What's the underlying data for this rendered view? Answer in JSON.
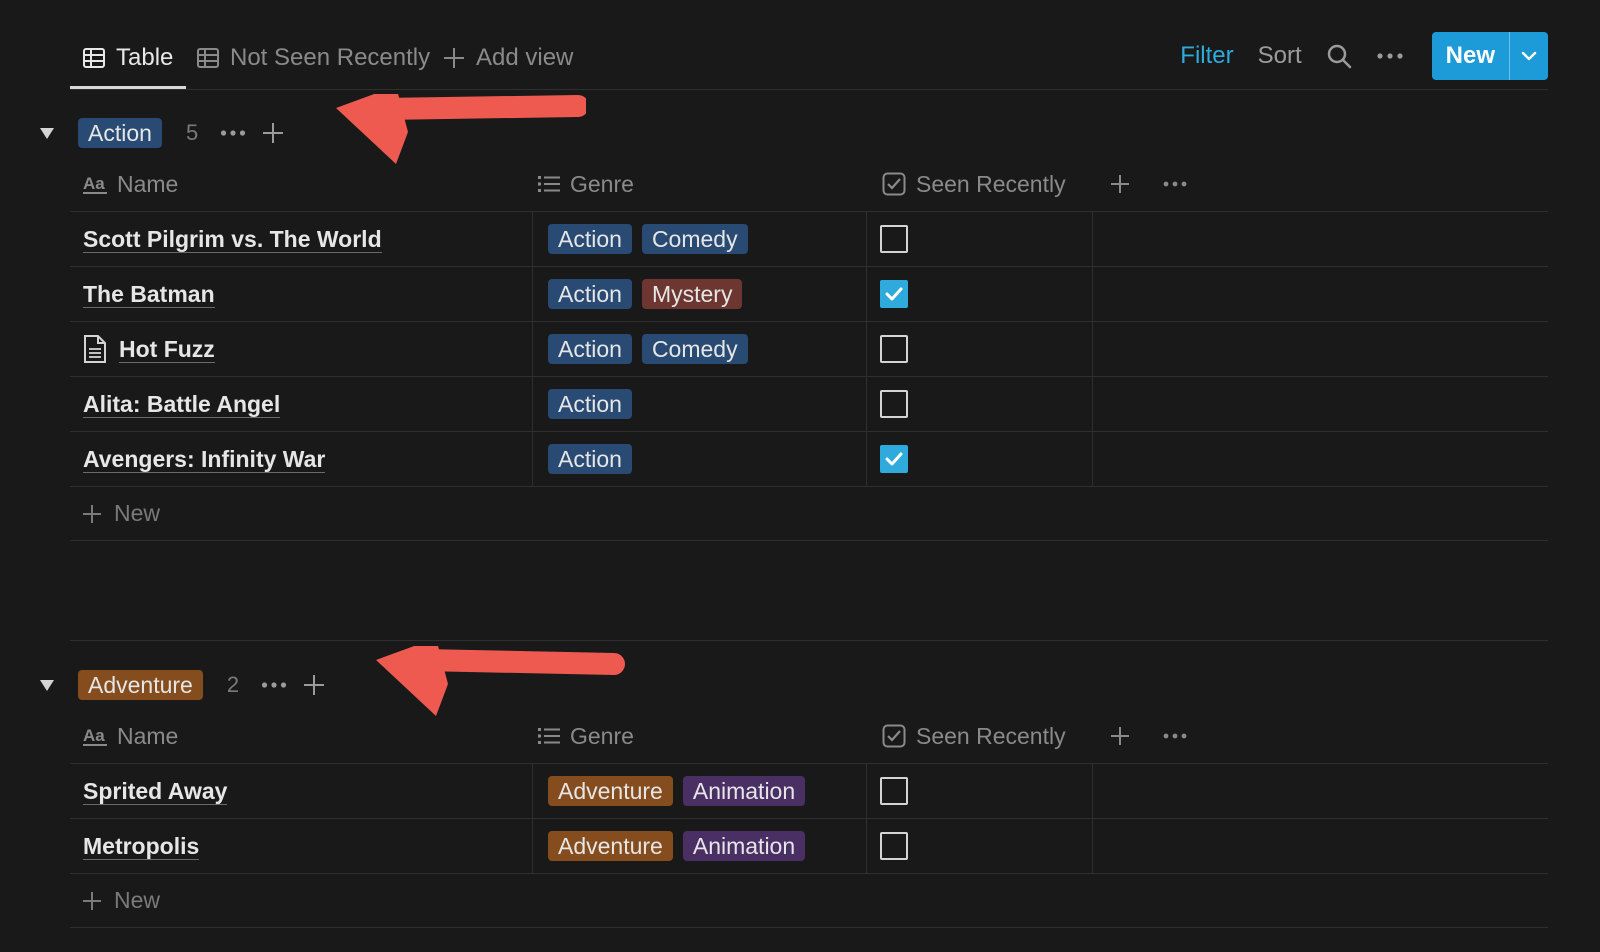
{
  "tabs": [
    {
      "label": "Table",
      "icon": "table-icon",
      "active": true
    },
    {
      "label": "Not Seen Recently",
      "icon": "table-icon",
      "active": false
    },
    {
      "label": "Add view",
      "icon": "plus-icon",
      "active": false
    }
  ],
  "toolbar": {
    "filter_label": "Filter",
    "sort_label": "Sort",
    "new_label": "New"
  },
  "columns": {
    "name": "Name",
    "genre": "Genre",
    "seen": "Seen Recently"
  },
  "colors": {
    "action": "#284a73",
    "comedy": "#284a73",
    "mystery": "#6e3630",
    "adventure": "#854c1d",
    "animation": "#492f64",
    "accent": "#2eaadc",
    "arrow": "#ee5a4f"
  },
  "groups": [
    {
      "label": "Action",
      "count": "5",
      "rows": [
        {
          "name": "Scott Pilgrim vs. The World",
          "genres": [
            "Action",
            "Comedy"
          ],
          "seen": false
        },
        {
          "name": "The Batman",
          "genres": [
            "Action",
            "Mystery"
          ],
          "seen": true
        },
        {
          "name": "Hot Fuzz",
          "genres": [
            "Action",
            "Comedy"
          ],
          "seen": false,
          "icon": "page-icon"
        },
        {
          "name": "Alita: Battle Angel",
          "genres": [
            "Action"
          ],
          "seen": false
        },
        {
          "name": "Avengers: Infinity War",
          "genres": [
            "Action"
          ],
          "seen": true
        }
      ],
      "new_label": "New"
    },
    {
      "label": "Adventure",
      "count": "2",
      "rows": [
        {
          "name": "Sprited Away",
          "genres": [
            "Adventure",
            "Animation"
          ],
          "seen": false
        },
        {
          "name": "Metropolis",
          "genres": [
            "Adventure",
            "Animation"
          ],
          "seen": false
        }
      ],
      "new_label": "New"
    }
  ]
}
